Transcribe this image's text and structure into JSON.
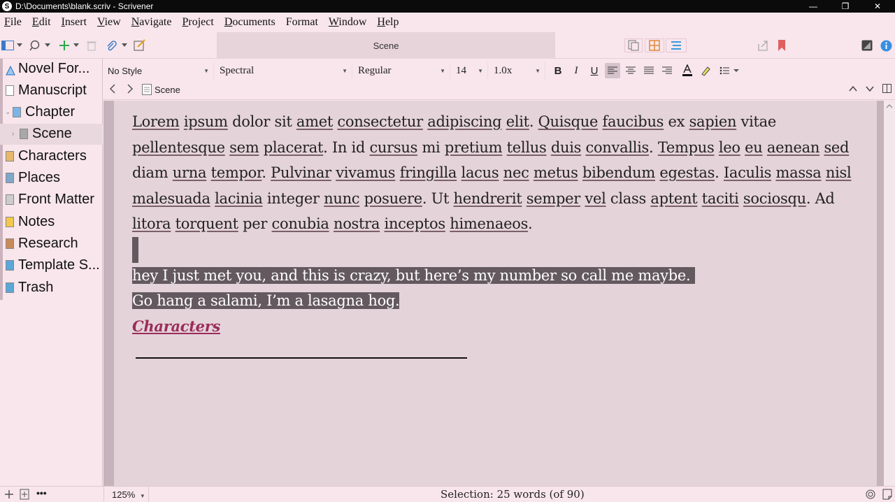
{
  "window": {
    "title": "D:\\Documents\\blank.scriv - Scrivener",
    "logo_letter": "S",
    "minimize": "—",
    "restore": "❐",
    "close": "✕"
  },
  "menu": [
    {
      "label": "File",
      "underline": "F",
      "rest": "ile"
    },
    {
      "label": "Edit",
      "underline": "E",
      "rest": "dit"
    },
    {
      "label": "Insert",
      "underline": "I",
      "rest": "nsert"
    },
    {
      "label": "View",
      "underline": "V",
      "rest": "iew"
    },
    {
      "label": "Navigate",
      "underline": "N",
      "rest": "avigate"
    },
    {
      "label": "Project",
      "underline": "P",
      "rest": "roject"
    },
    {
      "label": "Documents",
      "underline": "D",
      "rest": "ocuments"
    },
    {
      "label": "Format",
      "underline": "",
      "rest": "Format"
    },
    {
      "label": "Window",
      "underline": "W",
      "rest": "indow"
    },
    {
      "label": "Help",
      "underline": "H",
      "rest": "elp"
    }
  ],
  "toolbar": {
    "document_title": "Scene"
  },
  "binder": {
    "items": [
      {
        "label": "Novel For...",
        "icon": "project-icon",
        "color": "#4a8fd6"
      },
      {
        "label": "Manuscript",
        "icon": "manuscript-icon",
        "color": "#ffffff"
      },
      {
        "label": "Chapter",
        "icon": "folder-icon",
        "color": "#7db4e8"
      },
      {
        "label": "Scene",
        "icon": "scene-icon",
        "color": "#a8a8a8"
      },
      {
        "label": "Characters",
        "icon": "characters-icon",
        "color": "#e6b86a"
      },
      {
        "label": "Places",
        "icon": "places-icon",
        "color": "#7fa7c8"
      },
      {
        "label": "Front Matter",
        "icon": "front-matter-icon",
        "color": "#cccccc"
      },
      {
        "label": "Notes",
        "icon": "notes-icon",
        "color": "#f2c94c"
      },
      {
        "label": "Research",
        "icon": "research-icon",
        "color": "#c98a5a"
      },
      {
        "label": "Template S...",
        "icon": "template-icon",
        "color": "#5aa7d8"
      },
      {
        "label": "Trash",
        "icon": "trash-icon",
        "color": "#5aa7d8"
      }
    ]
  },
  "format": {
    "style": "No Style",
    "font": "Spectral",
    "weight": "Regular",
    "size": "14",
    "spacing": "1.0x"
  },
  "header": {
    "title": "Scene"
  },
  "editor": {
    "paragraph1": [
      {
        "t": "Lorem",
        "u": true
      },
      {
        "t": " "
      },
      {
        "t": "ipsum",
        "u": true
      },
      {
        "t": " dolor sit "
      },
      {
        "t": "amet",
        "u": true
      },
      {
        "t": " "
      },
      {
        "t": "consectetur",
        "u": true
      },
      {
        "t": " "
      },
      {
        "t": "adipiscing",
        "u": true
      },
      {
        "t": " "
      },
      {
        "t": "elit",
        "u": true
      },
      {
        "t": ". "
      },
      {
        "t": "Quisque",
        "u": true
      },
      {
        "t": " "
      },
      {
        "t": "faucibus",
        "u": true
      },
      {
        "t": " ex "
      },
      {
        "t": "sapien",
        "u": true
      },
      {
        "t": " vitae "
      },
      {
        "t": "pellentesque",
        "u": true
      },
      {
        "t": " "
      },
      {
        "t": "sem",
        "u": true
      },
      {
        "t": " "
      },
      {
        "t": "placerat",
        "u": true
      },
      {
        "t": ". In id "
      },
      {
        "t": "cursus",
        "u": true
      },
      {
        "t": " mi "
      },
      {
        "t": "pretium",
        "u": true
      },
      {
        "t": " "
      },
      {
        "t": "tellus",
        "u": true
      },
      {
        "t": " "
      },
      {
        "t": "duis",
        "u": true
      },
      {
        "t": " "
      },
      {
        "t": "convallis",
        "u": true
      },
      {
        "t": ". "
      },
      {
        "t": "Tempus",
        "u": true
      },
      {
        "t": " "
      },
      {
        "t": "leo",
        "u": true
      },
      {
        "t": " "
      },
      {
        "t": "eu",
        "u": true
      },
      {
        "t": " "
      },
      {
        "t": "aenean",
        "u": true
      },
      {
        "t": " "
      },
      {
        "t": "sed",
        "u": true
      },
      {
        "t": " diam "
      },
      {
        "t": "urna",
        "u": true
      },
      {
        "t": " "
      },
      {
        "t": "tempor",
        "u": true
      },
      {
        "t": ". "
      },
      {
        "t": "Pulvinar",
        "u": true
      },
      {
        "t": " "
      },
      {
        "t": "vivamus",
        "u": true
      },
      {
        "t": " "
      },
      {
        "t": "fringilla",
        "u": true
      },
      {
        "t": " "
      },
      {
        "t": "lacus",
        "u": true
      },
      {
        "t": " "
      },
      {
        "t": "nec",
        "u": true
      },
      {
        "t": " "
      },
      {
        "t": "metus",
        "u": true
      },
      {
        "t": " "
      },
      {
        "t": "bibendum",
        "u": true
      },
      {
        "t": " "
      },
      {
        "t": "egestas",
        "u": true
      },
      {
        "t": ". "
      },
      {
        "t": "Iaculis",
        "u": true
      },
      {
        "t": " "
      },
      {
        "t": "massa",
        "u": true
      },
      {
        "t": " "
      },
      {
        "t": "nisl",
        "u": true
      },
      {
        "t": " "
      },
      {
        "t": "malesuada",
        "u": true
      },
      {
        "t": " "
      },
      {
        "t": "lacinia",
        "u": true
      },
      {
        "t": " integer "
      },
      {
        "t": "nunc",
        "u": true
      },
      {
        "t": " "
      },
      {
        "t": "posuere",
        "u": true
      },
      {
        "t": ". Ut "
      },
      {
        "t": "hendrerit",
        "u": true
      },
      {
        "t": " "
      },
      {
        "t": "semper",
        "u": true
      },
      {
        "t": " "
      },
      {
        "t": "vel",
        "u": true
      },
      {
        "t": " class "
      },
      {
        "t": "aptent",
        "u": true
      },
      {
        "t": " "
      },
      {
        "t": "taciti",
        "u": true
      },
      {
        "t": " "
      },
      {
        "t": "sociosqu",
        "u": true
      },
      {
        "t": ". Ad "
      },
      {
        "t": "litora",
        "u": true
      },
      {
        "t": " "
      },
      {
        "t": "torquent",
        "u": true
      },
      {
        "t": " "
      },
      {
        "t": "per "
      },
      {
        "t": "conubia",
        "u": true
      },
      {
        "t": " "
      },
      {
        "t": "nostra",
        "u": true
      },
      {
        "t": " "
      },
      {
        "t": "inceptos",
        "u": true
      },
      {
        "t": " "
      },
      {
        "t": "himenaeos",
        "u": true
      },
      {
        "t": "."
      }
    ],
    "selected_line1": "hey I just met you, and this is crazy, but here’s my number so call me maybe. ",
    "selected_line2": "Go hang a salami, I’m a lasagna hog.",
    "link_text": "Characters",
    "colors": {
      "selection": "#64595f",
      "link": "#9a2d58",
      "page": "#e5d3da"
    }
  },
  "footer": {
    "zoom": "125%",
    "status": "Selection: 25 words (of 90)"
  }
}
